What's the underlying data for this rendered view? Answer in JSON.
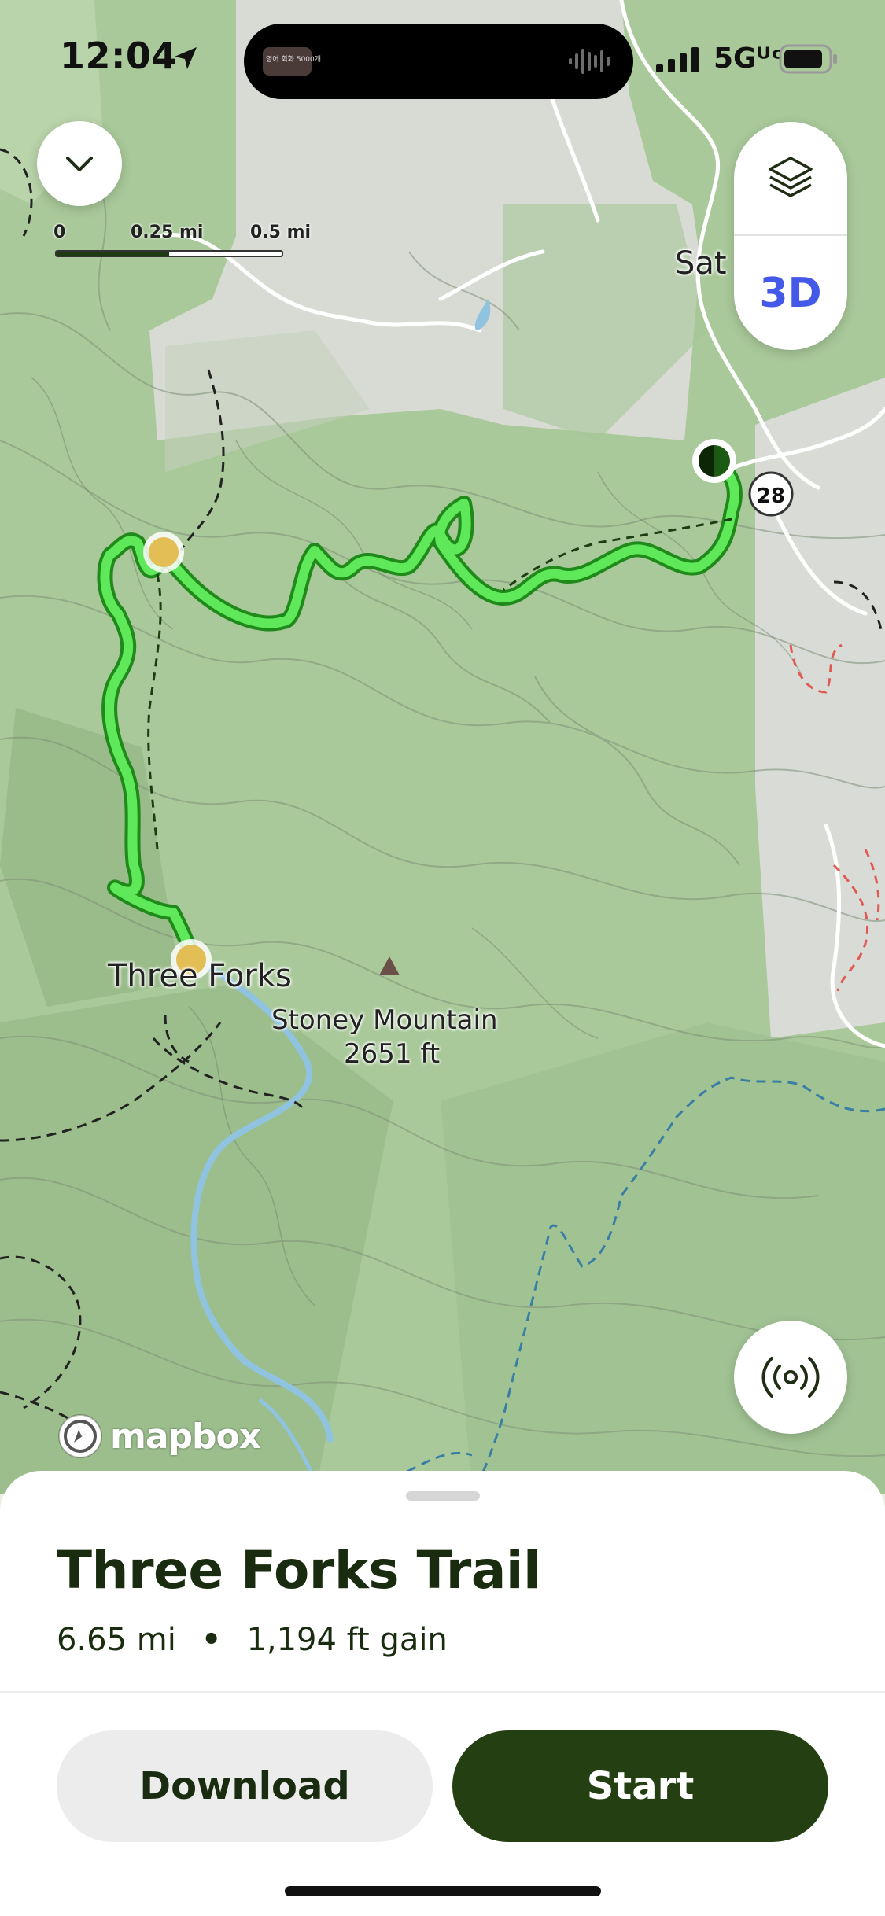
{
  "status_bar": {
    "time": "12:04",
    "network": "5Gᵁᶜ",
    "island_thumbnail_text": "영어 회화 5000개"
  },
  "map": {
    "scale": {
      "labels": [
        "0",
        "0.25 mi",
        "0.5 mi"
      ]
    },
    "place_labels": {
      "three_forks": "Three Forks",
      "stoney_mountain": "Stoney Mountain",
      "stoney_elevation": "2651 ft",
      "partial_town": "Sat",
      "route_shield": "28"
    },
    "attribution": "mapbox",
    "controls": {
      "collapse_icon": "chevron-down-icon",
      "layers_icon": "layers-icon",
      "three_d_label": "3D",
      "location_icon": "broadcast-location-icon"
    },
    "colors": {
      "trail": "#52e04a",
      "trail_outline": "#1f8a1a",
      "river": "#8fc3e0",
      "start_marker": "#1d5a13"
    }
  },
  "sheet": {
    "title": "Three Forks Trail",
    "distance": "6.65 mi",
    "separator": "•",
    "gain": "1,194 ft gain",
    "download_label": "Download",
    "start_label": "Start"
  }
}
